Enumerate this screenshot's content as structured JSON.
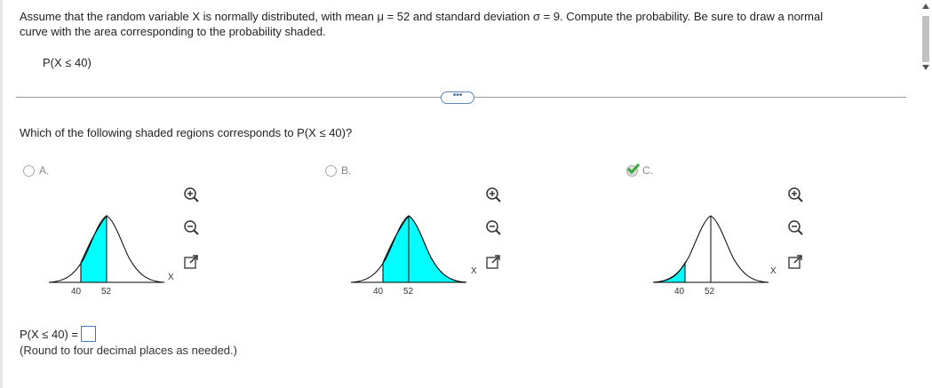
{
  "prompt": {
    "line1": "Assume that the random variable X is normally distributed, with mean μ = 52 and standard deviation σ = 9. Compute the probability. Be sure to draw a normal",
    "line2": "curve with the area corresponding to the probability shaded.",
    "given": "P(X ≤ 40)"
  },
  "more_button": "•••",
  "question": "Which of the following shaded regions corresponds to P(X ≤ 40)?",
  "options": [
    {
      "label": "A.",
      "tick_low": "40",
      "tick_mean": "52",
      "axis": "X",
      "shading": "between 40 and 52",
      "selected": false
    },
    {
      "label": "B.",
      "tick_low": "40",
      "tick_mean": "52",
      "axis": "X",
      "shading": "above 40",
      "selected": false
    },
    {
      "label": "C.",
      "tick_low": "40",
      "tick_mean": "52",
      "axis": "X",
      "shading": "below 40",
      "selected": true
    }
  ],
  "tools": [
    "zoom-in-icon",
    "zoom-out-icon",
    "open-external-icon"
  ],
  "answer": {
    "prefix": "P(X ≤ 40) =",
    "value": "",
    "note": "(Round to four decimal places as needed.)"
  },
  "colors": {
    "shade": "#00ffff",
    "check": "#3aa93a",
    "link": "#3c7dc4"
  }
}
